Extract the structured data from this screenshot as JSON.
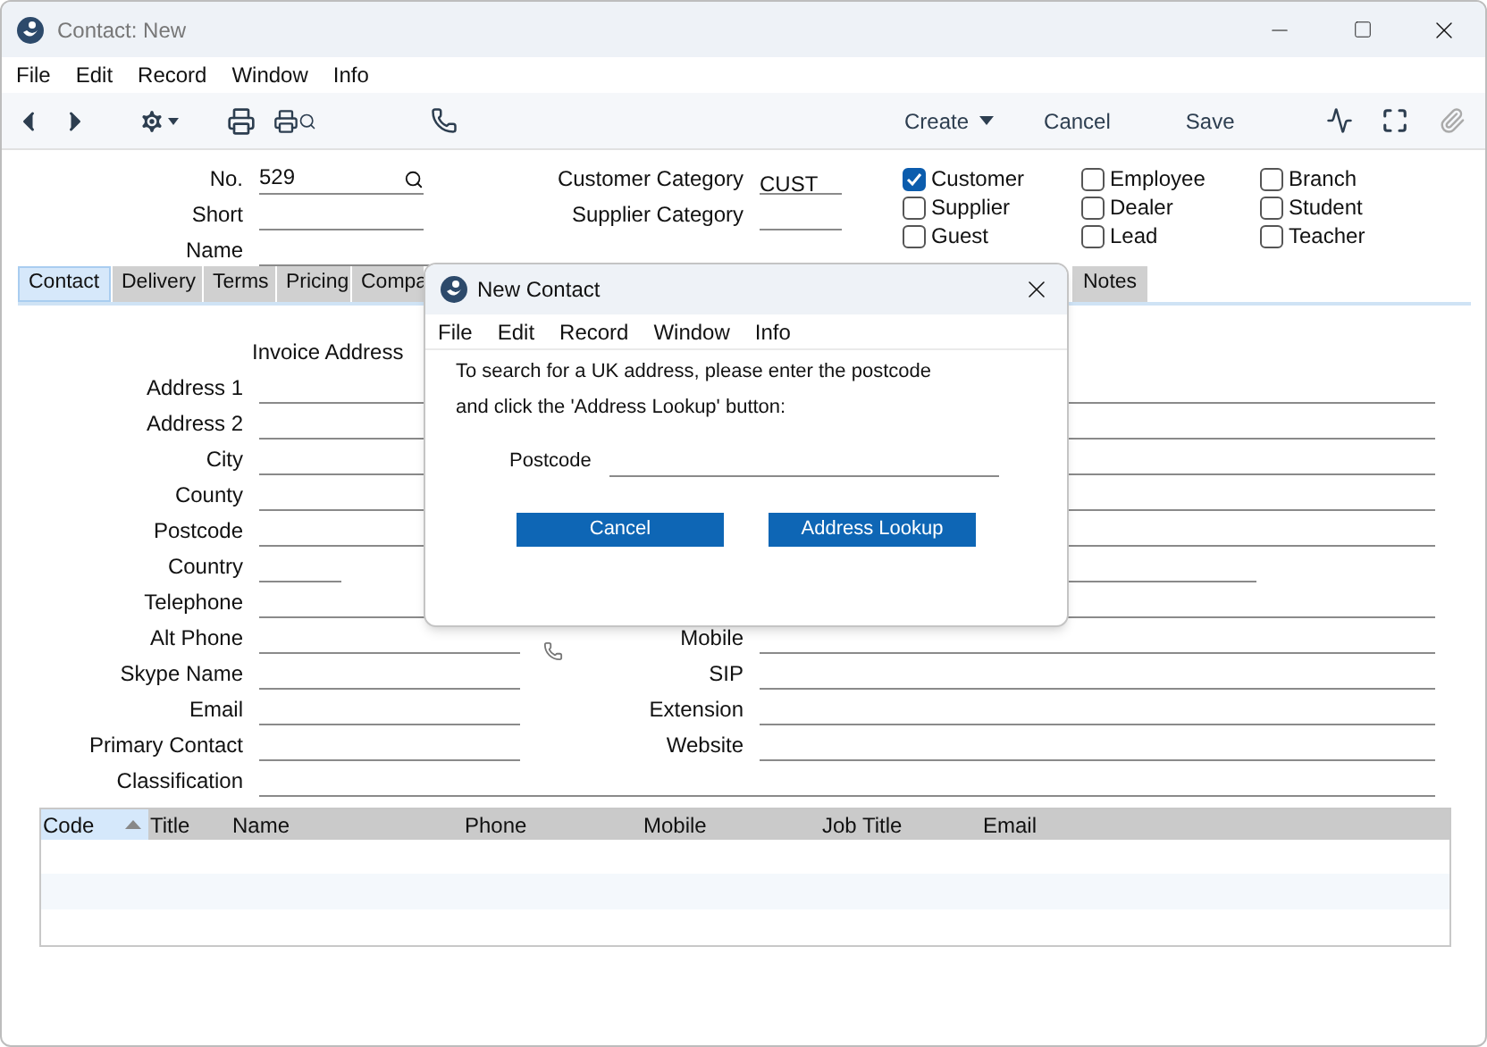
{
  "window": {
    "title": "Contact: New"
  },
  "menu": [
    "File",
    "Edit",
    "Record",
    "Window",
    "Info"
  ],
  "toolbar": {
    "create": "Create",
    "cancel": "Cancel",
    "save": "Save"
  },
  "header": {
    "no": {
      "label": "No.",
      "value": "529"
    },
    "short": {
      "label": "Short"
    },
    "name": {
      "label": "Name"
    },
    "customer_category": {
      "label": "Customer Category",
      "value": "CUST"
    },
    "supplier_category": {
      "label": "Supplier Category"
    }
  },
  "checkboxes": [
    {
      "label": "Customer",
      "checked": true
    },
    {
      "label": "Supplier",
      "checked": false
    },
    {
      "label": "Guest",
      "checked": false
    },
    {
      "label": "Employee",
      "checked": false
    },
    {
      "label": "Dealer",
      "checked": false
    },
    {
      "label": "Lead",
      "checked": false
    },
    {
      "label": "Branch",
      "checked": false
    },
    {
      "label": "Student",
      "checked": false
    },
    {
      "label": "Teacher",
      "checked": false
    }
  ],
  "tabs": [
    {
      "label": "Contact",
      "selected": true
    },
    {
      "label": "Delivery",
      "selected": false
    },
    {
      "label": "Terms",
      "selected": false
    },
    {
      "label": "Pricing",
      "selected": false
    },
    {
      "label": "Compa",
      "selected": false
    },
    {
      "label": "Notes",
      "selected": false
    }
  ],
  "invoice_heading": "Invoice Address",
  "left_fields": [
    {
      "label": "Address 1",
      "kind": "line"
    },
    {
      "label": "Address 2",
      "kind": "line"
    },
    {
      "label": "City",
      "kind": "line"
    },
    {
      "label": "County",
      "kind": "line"
    },
    {
      "label": "Postcode",
      "kind": "line"
    },
    {
      "label": "Country",
      "kind": "short"
    },
    {
      "label": "Telephone",
      "kind": "line"
    },
    {
      "label": "Alt Phone",
      "kind": "phone"
    },
    {
      "label": "Skype Name",
      "kind": "line"
    },
    {
      "label": "Email",
      "kind": "line"
    },
    {
      "label": "Primary Contact",
      "kind": "line"
    },
    {
      "label": "Classification",
      "kind": "wide"
    }
  ],
  "right_fields": [
    {
      "label": "Mobile"
    },
    {
      "label": "SIP"
    },
    {
      "label": "Extension"
    },
    {
      "label": "Website"
    }
  ],
  "table": {
    "columns": [
      {
        "label": "Code",
        "sorted": true
      },
      {
        "label": "Title",
        "sorted": false
      },
      {
        "label": "Name",
        "sorted": false
      },
      {
        "label": "Phone",
        "sorted": false
      },
      {
        "label": "Mobile",
        "sorted": false
      },
      {
        "label": "Job Title",
        "sorted": false
      },
      {
        "label": "Email",
        "sorted": false
      }
    ]
  },
  "dialog": {
    "title": "New Contact",
    "menu": [
      "File",
      "Edit",
      "Record",
      "Window",
      "Info"
    ],
    "message": [
      "To search for a UK address, please enter the postcode",
      "and click the 'Address Lookup' button:"
    ],
    "postcode_label": "Postcode",
    "buttons": [
      "Cancel",
      "Address Lookup"
    ]
  }
}
